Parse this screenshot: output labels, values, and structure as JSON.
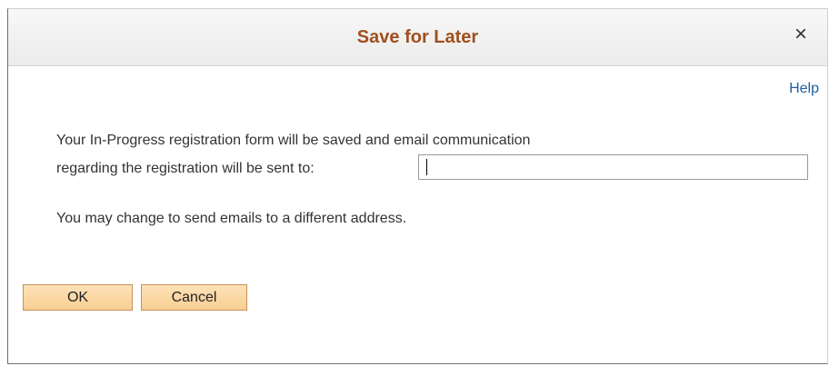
{
  "dialog": {
    "title": "Save for Later",
    "close_glyph": "×",
    "help_link": "Help",
    "body": {
      "line1": "Your In-Progress registration form will be saved and email communication",
      "line2": "regarding the registration will be sent to:",
      "line3": "You may change to send emails to a different address."
    },
    "email_input": {
      "value": "",
      "placeholder": ""
    },
    "buttons": {
      "ok_label": "OK",
      "cancel_label": "Cancel"
    }
  },
  "icons": {
    "close": "close-icon"
  },
  "colors": {
    "title": "#a0501e",
    "link": "#1f5fa0",
    "button_bg": "#f8cf93",
    "button_border": "#c89158"
  }
}
